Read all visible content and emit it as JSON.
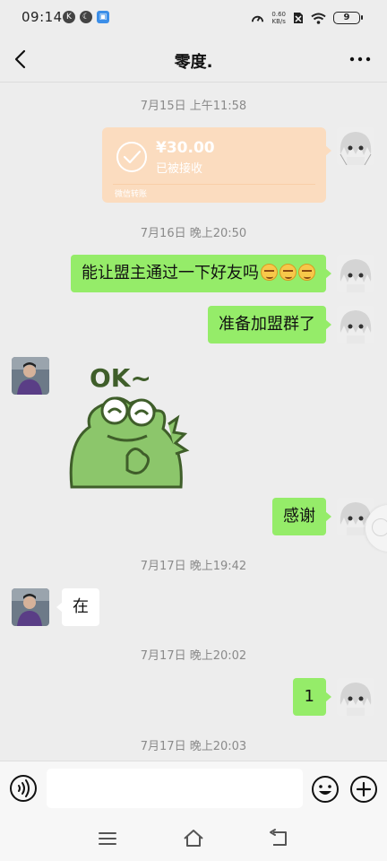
{
  "status_bar": {
    "time": "09:14",
    "left_icons": [
      "k-icon",
      "moon-icon",
      "app-badge-icon"
    ],
    "network_speed": "0.60\nKB/s",
    "battery_level": "9"
  },
  "header": {
    "title": "零度."
  },
  "messages": {
    "ts1": "7月15日 上午11:58",
    "transfer": {
      "amount": "¥30.00",
      "status": "已被接收",
      "footer": "微信转账",
      "color": "#fbdcbf"
    },
    "ts2": "7月16日 晚上20:50",
    "msg1": "能让盟主通过一下好友吗",
    "msg2": "准备加盟群了",
    "sticker_text": "OK~",
    "msg3": "感谢",
    "ts3": "7月17日 晚上19:42",
    "msg4": "在",
    "ts4": "7月17日 晚上20:02",
    "msg5": "1",
    "ts5": "7月17日 晚上20:03"
  },
  "input": {
    "placeholder": ""
  },
  "colors": {
    "sent_bubble": "#95ec69",
    "received_bubble": "#ffffff",
    "background": "#ededed"
  }
}
